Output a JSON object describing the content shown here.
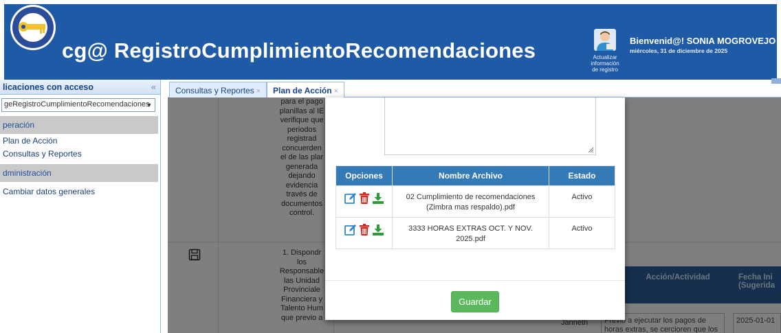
{
  "header": {
    "brand": "cg@",
    "title": "RegistroCumplimientoRecomendaciones",
    "avatar_label": [
      "Actualizar",
      "información",
      "de registro"
    ],
    "welcome": "Bienvenid@! SONIA MOGROVEJO",
    "date": "miércoles, 31 de diciembre de 2025",
    "colors": {
      "bar": "#1f5aa6",
      "text": "#ffffff"
    }
  },
  "sidebar": {
    "title": "licaciones con acceso",
    "selected_app": "geRegistroCumplimientoRecomendaciones",
    "sections": [
      {
        "label": "peración",
        "items": [
          "Plan de Acción",
          "Consultas y Reportes"
        ]
      },
      {
        "label": "dministración",
        "items": [
          "Cambiar datos generales"
        ]
      }
    ]
  },
  "tabs": [
    {
      "label": "Consultas y Reportes",
      "active": false
    },
    {
      "label": "Plan de Acción",
      "active": true
    }
  ],
  "background": {
    "row1_text": [
      "para el pago",
      "planillas al IE",
      "verifique que",
      "periodos",
      "registrad",
      "concuerden",
      "el de las plar",
      "generada",
      "dejando",
      "evidencia",
      "través de",
      "documentos",
      "control."
    ],
    "row2_text": [
      "1. Dispondr",
      "los",
      "Responsable",
      "las Unidad",
      "Provinciale",
      "Financiera y",
      "Talento Hum",
      "que previo a"
    ],
    "headers": [
      "Acción/Actividad",
      "Fecha Ini",
      "(Sugerida"
    ],
    "cells": [
      "Janneth",
      "Previo a ejecutar los pagos de",
      "horas extras, se cercioren que los",
      "2025-01-01"
    ]
  },
  "modal": {
    "table": {
      "columns": [
        "Opciones",
        "Nombre Archivo",
        "Estado"
      ],
      "rows": [
        {
          "file": [
            "02 Cumplimiento de recomendaciones",
            "(Zimbra mas respaldo).pdf"
          ],
          "status": "Activo"
        },
        {
          "file": [
            "3333 HORAS EXTRAS OCT. Y NOV.",
            "2025.pdf"
          ],
          "status": "Activo"
        }
      ],
      "icons": [
        "edit-icon",
        "delete-icon",
        "download-icon"
      ]
    },
    "save_label": "Guardar",
    "colors": {
      "table_head": "#337ab7",
      "save_button": "#5cb85c"
    }
  }
}
